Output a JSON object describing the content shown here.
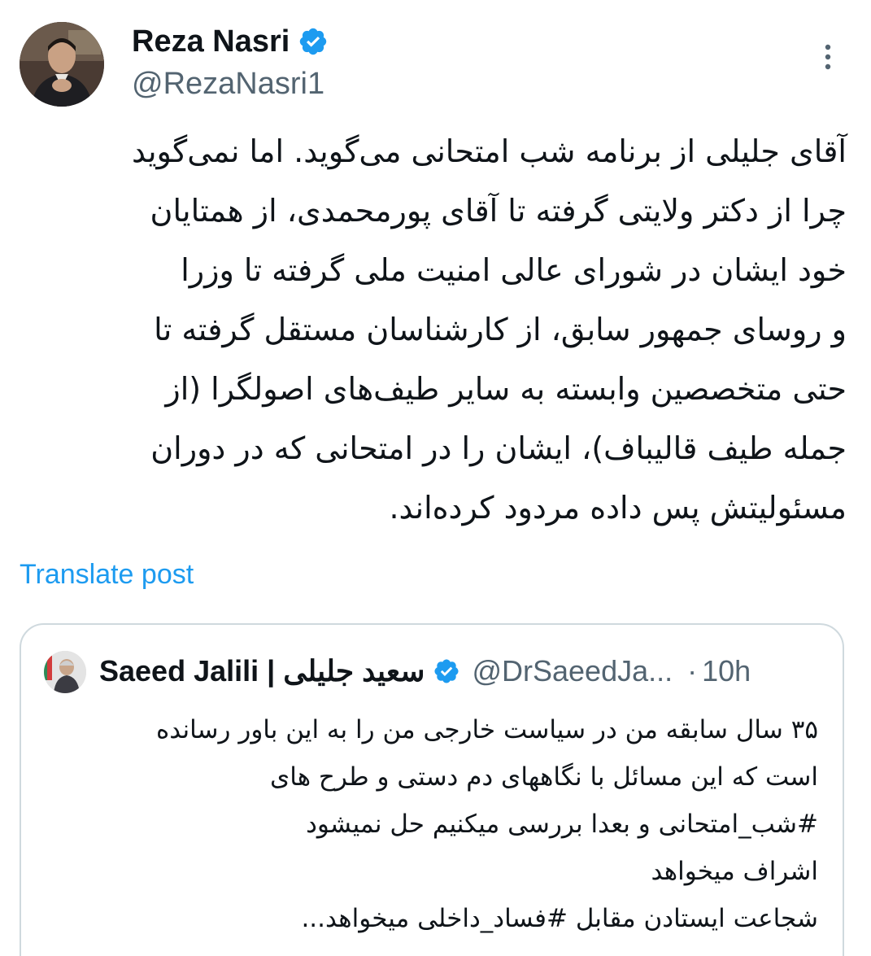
{
  "author": {
    "name": "Reza Nasri",
    "handle": "@RezaNasri1",
    "verified": true,
    "avatar_icon": "avatar-photo"
  },
  "tweet": {
    "lines": [
      "آقای جلیلی از برنامه شب امتحانی می‌گوید. اما نمی‌گوید",
      "چرا از دکتر ولایتی گرفته تا آقای پورمحمدی، از همتایان",
      "خود ایشان در شورای عالی امنیت ملی گرفته تا وزرا",
      "و روسای جمهور سابق، از کارشناسان مستقل گرفته تا",
      "حتی متخصصین وابسته به سایر طیف‌های اصولگرا (از",
      "جمله طیف قالیباف)، ایشان را در امتحانی که در دوران",
      "مسئولیتش پس داده مردود کرده‌اند."
    ],
    "translate_label": "Translate post"
  },
  "quote": {
    "name": "Saeed Jalili | سعید جلیلی",
    "handle": "@DrSaeedJa...",
    "separator": "·",
    "time": "10h",
    "verified": true,
    "lines": [
      "۳۵ سال سابقه من در سیاست خارجی من را به این باور رسانده",
      "است که این مسائل با نگاههای دم دستی و طرح های",
      "#شب_امتحانی و بعدا بررسی میکنیم حل نمیشود",
      "اشراف میخواهد",
      "شجاعت ایستادن مقابل #فساد_داخلی میخواهد..."
    ]
  },
  "colors": {
    "accent": "#1d9bf0",
    "text": "#0f1419",
    "secondary": "#536471",
    "border": "#cfd9de"
  },
  "icons": {
    "verified": "verified-badge-icon",
    "more": "more-vertical-icon"
  }
}
